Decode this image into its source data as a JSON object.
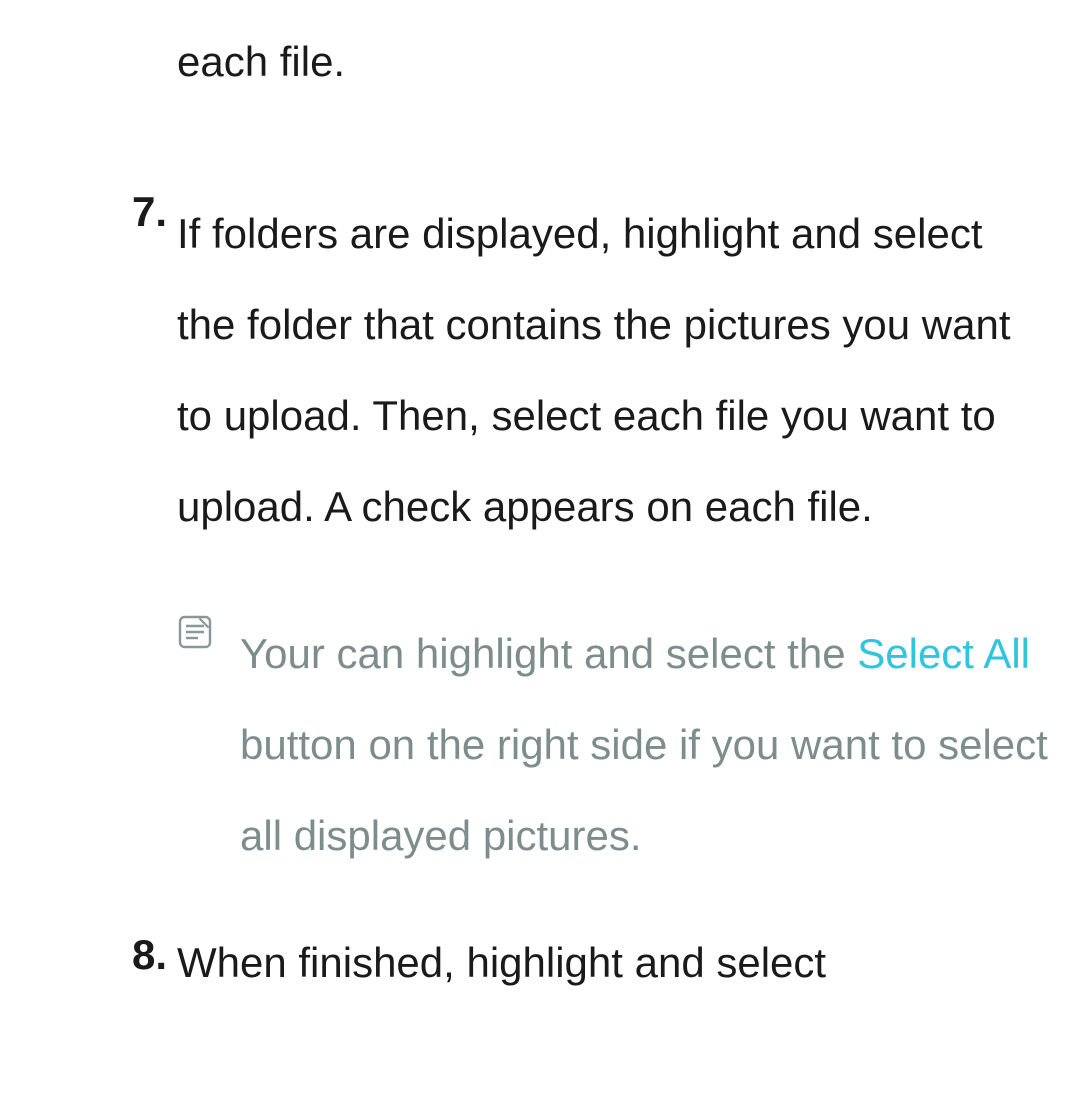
{
  "fragment_top": "each file.",
  "steps": {
    "item7": {
      "number": "7.",
      "text": "If folders are displayed, highlight and select the folder that contains the pictures you want to upload. Then, select each file you want to upload. A check appears on each file."
    },
    "note": {
      "before": "Your can highlight and select the ",
      "select_all_label": "Select All",
      "after": " button on the right side if you want to select all displayed pictures."
    },
    "item8": {
      "number": "8.",
      "text": "When finished, highlight and select"
    }
  }
}
